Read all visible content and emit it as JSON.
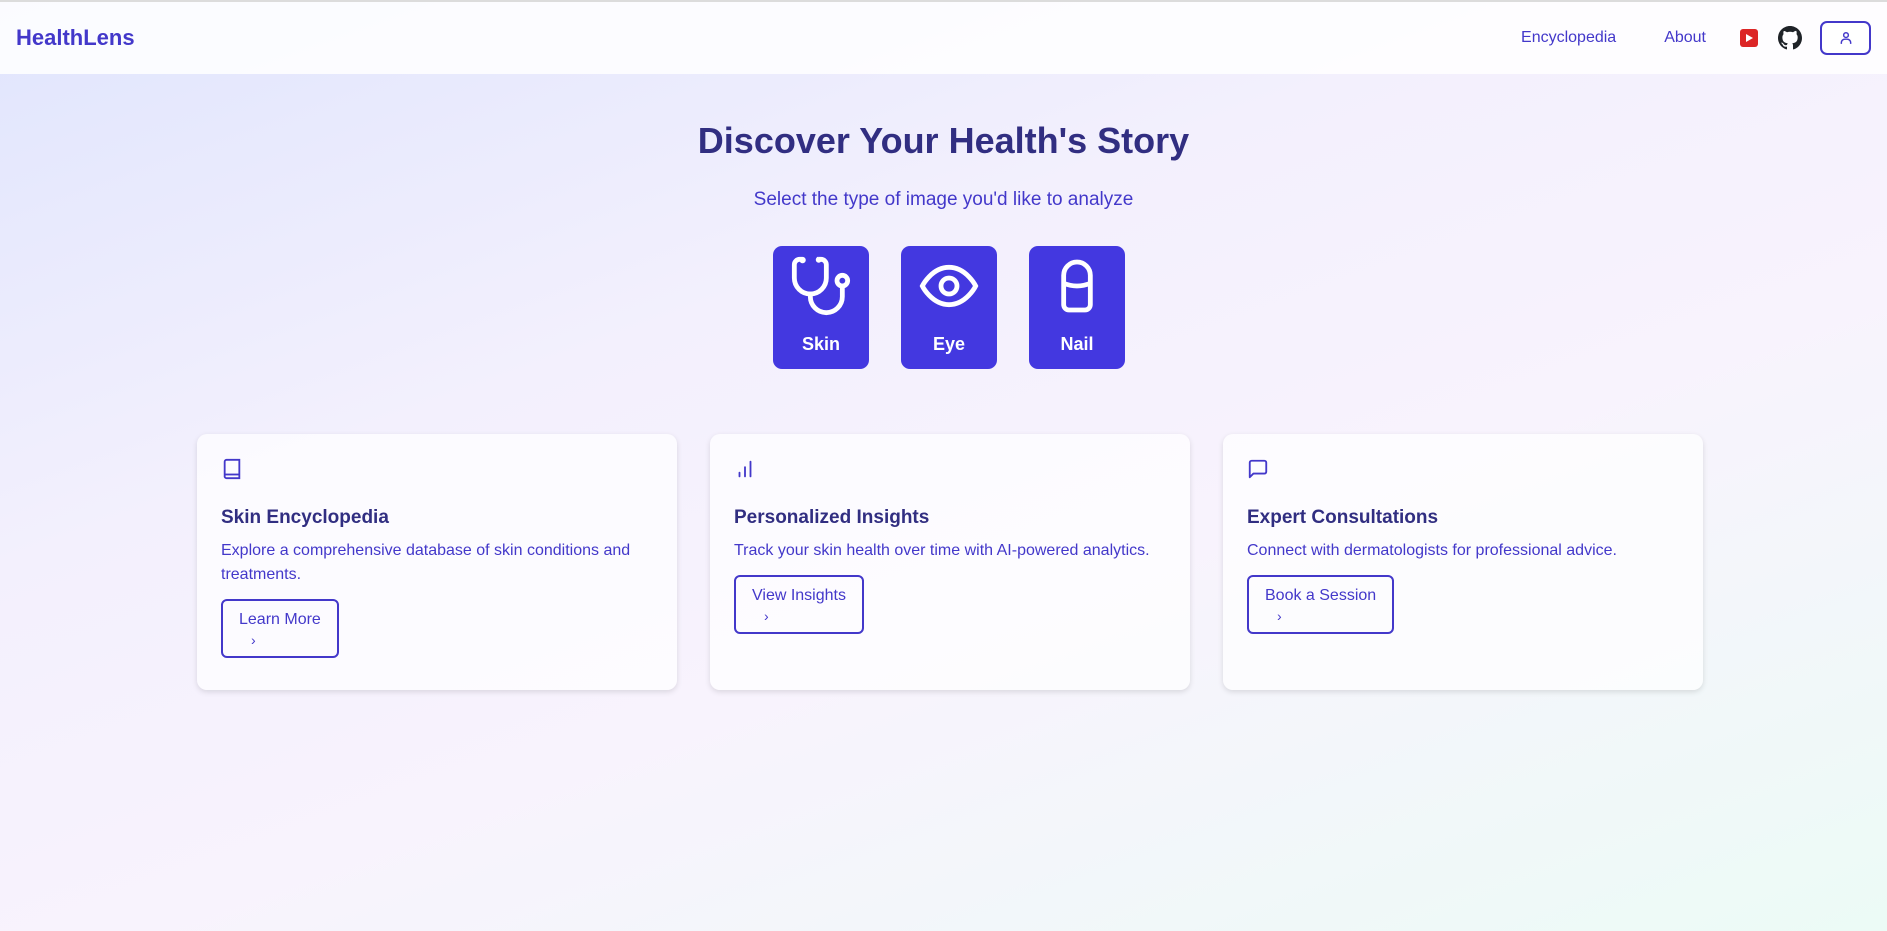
{
  "header": {
    "logo": "HealthLens",
    "nav": {
      "encyclopedia": "Encyclopedia",
      "about": "About"
    }
  },
  "hero": {
    "title": "Discover Your Health's Story",
    "subtitle": "Select the type of image you'd like to analyze"
  },
  "image_types": [
    {
      "label": "Skin",
      "icon": "stethoscope-icon"
    },
    {
      "label": "Eye",
      "icon": "eye-icon"
    },
    {
      "label": "Nail",
      "icon": "nail-icon"
    }
  ],
  "cards": [
    {
      "icon": "book-icon",
      "title": "Skin Encyclopedia",
      "description": "Explore a comprehensive database of skin conditions and treatments.",
      "button": "Learn More"
    },
    {
      "icon": "bar-chart-icon",
      "title": "Personalized Insights",
      "description": "Track your skin health over time with AI-powered analytics.",
      "button": "View Insights"
    },
    {
      "icon": "message-icon",
      "title": "Expert Consultations",
      "description": "Connect with dermatologists for professional advice.",
      "button": "Book a Session"
    }
  ],
  "colors": {
    "accent": "#4338ca",
    "tile": "#4338e0",
    "heading": "#312e81",
    "youtube": "#dc2626"
  }
}
